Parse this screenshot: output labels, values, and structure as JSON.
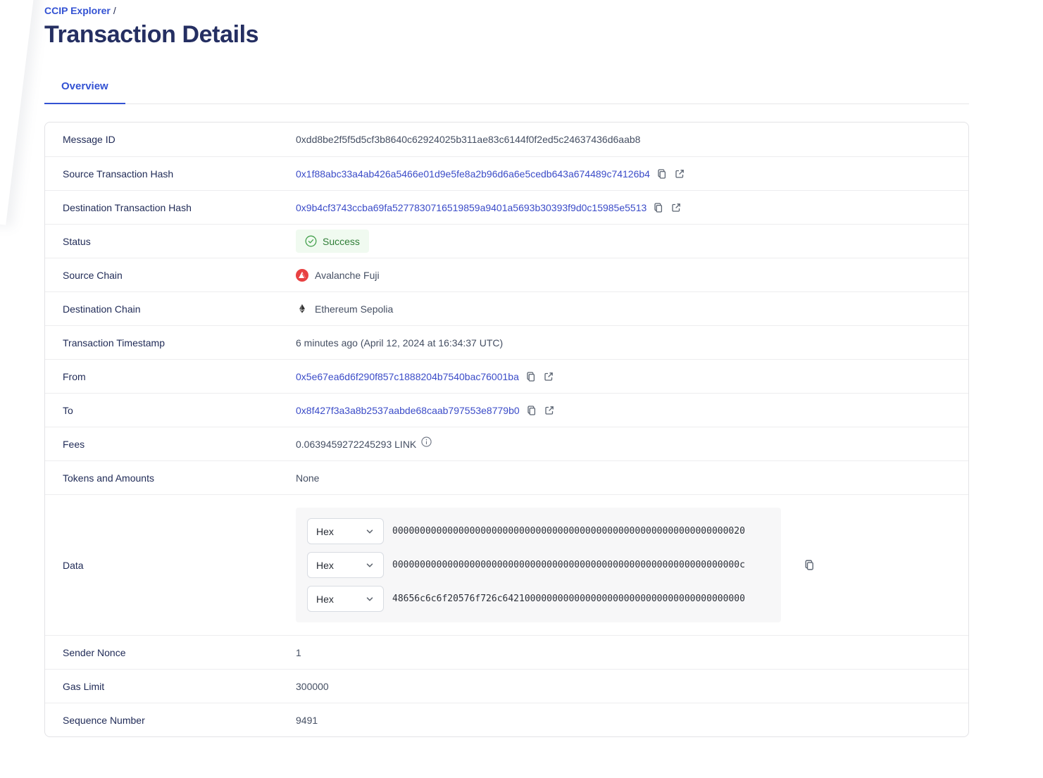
{
  "breadcrumb": {
    "link_label": "CCIP Explorer",
    "separator": "/"
  },
  "header": {
    "title": "Transaction Details"
  },
  "tabs": {
    "overview_label": "Overview"
  },
  "fields": {
    "message_id": {
      "label": "Message ID",
      "value": "0xdd8be2f5f5d5cf3b8640c62924025b311ae83c6144f0f2ed5c24637436d6aab8"
    },
    "source_tx_hash": {
      "label": "Source Transaction Hash",
      "value": "0x1f88abc33a4ab426a5466e01d9e5fe8a2b96d6a6e5cedb643a674489c74126b4"
    },
    "dest_tx_hash": {
      "label": "Destination Transaction Hash",
      "value": "0x9b4cf3743ccba69fa5277830716519859a9401a5693b30393f9d0c15985e5513"
    },
    "status": {
      "label": "Status",
      "value": "Success"
    },
    "source_chain": {
      "label": "Source Chain",
      "value": "Avalanche Fuji"
    },
    "dest_chain": {
      "label": "Destination Chain",
      "value": "Ethereum Sepolia"
    },
    "timestamp": {
      "label": "Transaction Timestamp",
      "value": "6 minutes ago (April 12, 2024 at 16:34:37 UTC)"
    },
    "from": {
      "label": "From",
      "value": "0x5e67ea6d6f290f857c1888204b7540bac76001ba"
    },
    "to": {
      "label": "To",
      "value": "0x8f427f3a3a8b2537aabde68caab797553e8779b0"
    },
    "fees": {
      "label": "Fees",
      "value": "0.0639459272245293 LINK"
    },
    "tokens": {
      "label": "Tokens and Amounts",
      "value": "None"
    },
    "data": {
      "label": "Data",
      "format_selector": "Hex",
      "lines": [
        "0000000000000000000000000000000000000000000000000000000000000020",
        "000000000000000000000000000000000000000000000000000000000000000c",
        "48656c6c6f20576f726c64210000000000000000000000000000000000000000"
      ]
    },
    "sender_nonce": {
      "label": "Sender Nonce",
      "value": "1"
    },
    "gas_limit": {
      "label": "Gas Limit",
      "value": "300000"
    },
    "sequence_number": {
      "label": "Sequence Number",
      "value": "9491"
    }
  },
  "icons": {
    "copy": "copy-icon",
    "external_link": "external-link-icon",
    "info": "info-icon",
    "check_circle": "check-circle-icon",
    "chevron_down": "chevron-down-icon",
    "avalanche_logo": "avalanche-logo-icon",
    "ethereum_logo": "ethereum-logo-icon"
  },
  "colors": {
    "accent_blue": "#3352d3",
    "link_blue": "#3b4cc8",
    "title_navy": "#252f62",
    "label_navy": "#1f2a56",
    "success_text": "#2f7d36",
    "success_bg": "#f0faf0",
    "success_icon": "#44a04d",
    "avalanche_red": "#e84142",
    "ethereum_dark": "#343434",
    "data_box_bg": "#f7f7f8"
  }
}
